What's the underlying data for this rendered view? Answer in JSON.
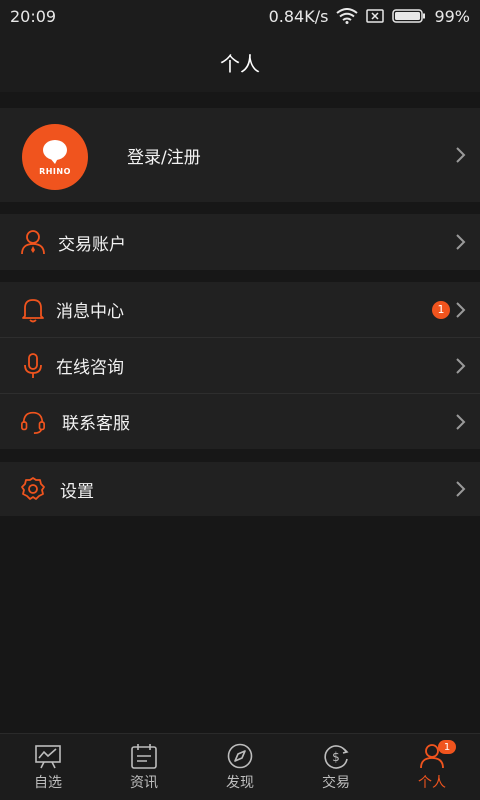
{
  "status_bar": {
    "time": "20:09",
    "network_speed": "0.84K/s",
    "battery": "99%"
  },
  "header": {
    "title": "个人"
  },
  "profile": {
    "avatar_text": "RHINO",
    "login_label": "登录/注册"
  },
  "menu": {
    "trade_account": "交易账户",
    "messages": "消息中心",
    "messages_badge": "1",
    "consult": "在线咨询",
    "service": "联系客服",
    "settings": "设置"
  },
  "bottom_nav": {
    "items": [
      {
        "label": "自选",
        "icon": "chart-board-icon"
      },
      {
        "label": "资讯",
        "icon": "calendar-news-icon"
      },
      {
        "label": "发现",
        "icon": "compass-icon"
      },
      {
        "label": "交易",
        "icon": "dollar-circle-icon"
      },
      {
        "label": "个人",
        "icon": "person-icon",
        "badge": "1"
      }
    ],
    "active_index": 4
  },
  "colors": {
    "accent": "#f0541e",
    "background": "#171717",
    "row": "#212121"
  }
}
